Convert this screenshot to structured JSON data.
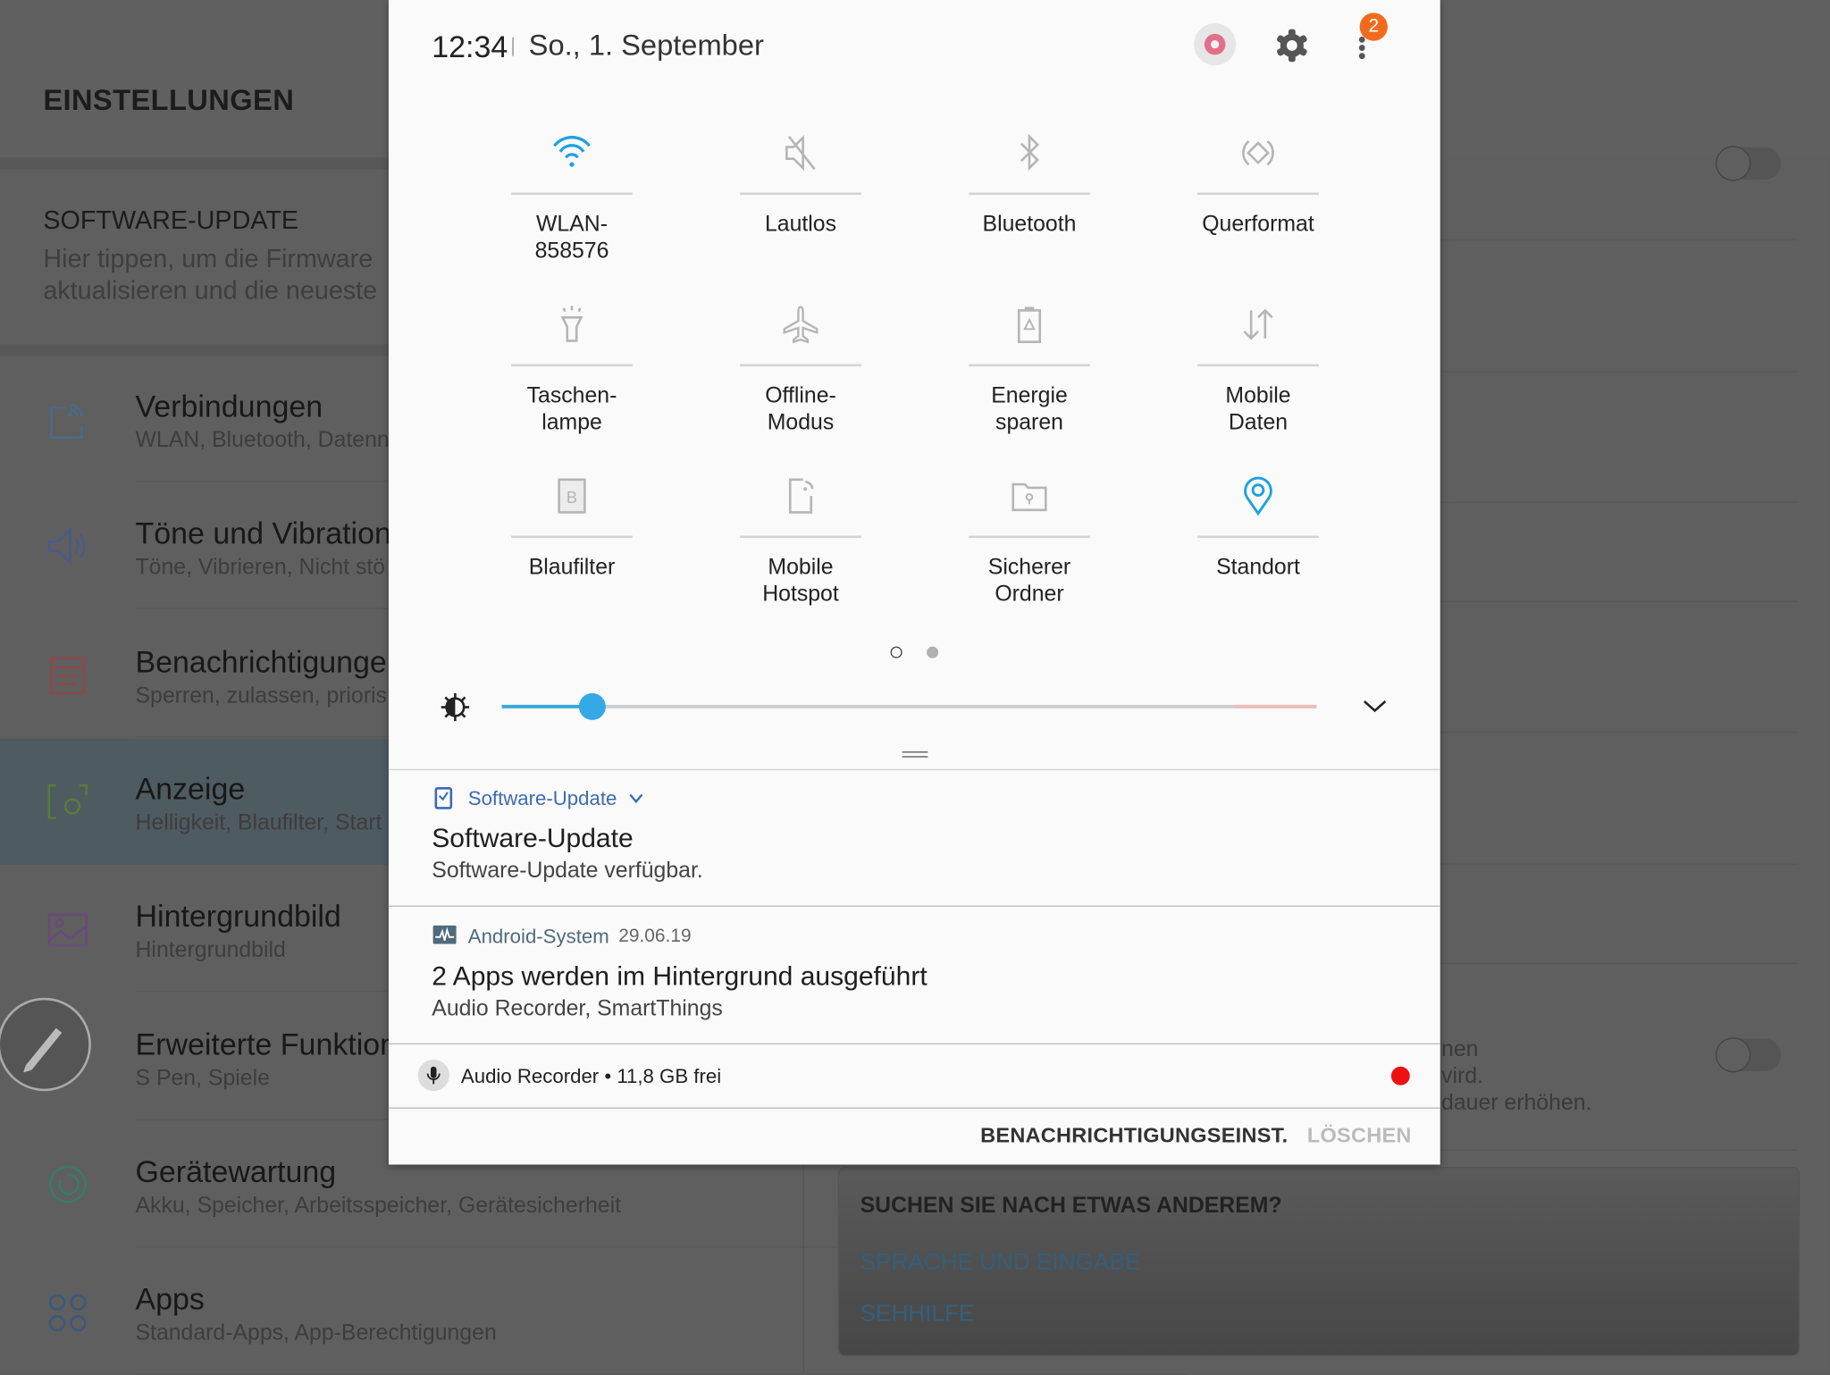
{
  "background": {
    "title": "EINSTELLUNGEN",
    "software_update": {
      "title": "SOFTWARE-UPDATE",
      "text_line1": "Hier tippen, um die Firmware",
      "text_line2": "aktualisieren und die neueste"
    },
    "items": [
      {
        "title": "Verbindungen",
        "subtitle": "WLAN, Bluetooth, Datenn",
        "icon": "connections-icon",
        "color": "#4a6a8a"
      },
      {
        "title": "Töne und Vibration",
        "subtitle": "Töne, Vibrieren, Nicht stö",
        "icon": "speaker-icon",
        "color": "#4a5a8a"
      },
      {
        "title": "Benachrichtigungen",
        "subtitle": "Sperren, zulassen, prioris",
        "icon": "notifications-icon",
        "color": "#8a4a4a"
      },
      {
        "title": "Anzeige",
        "subtitle": "Helligkeit, Blaufilter, Start",
        "icon": "display-icon",
        "color": "#5a7a3a",
        "selected": true
      },
      {
        "title": "Hintergrundbild",
        "subtitle": "Hintergrundbild",
        "icon": "wallpaper-icon",
        "color": "#6a4a7a"
      },
      {
        "title": "Erweiterte Funktion",
        "subtitle": "S Pen, Spiele",
        "icon": "advanced-features-icon",
        "color": "#7a6a3a"
      },
      {
        "title": "Gerätewartung",
        "subtitle": "Akku, Speicher, Arbeitsspeicher, Gerätesicherheit",
        "icon": "device-care-icon",
        "color": "#3a7a6a"
      },
      {
        "title": "Apps",
        "subtitle": "Standard-Apps, App-Berechtigungen",
        "icon": "apps-icon",
        "color": "#3a5a7a"
      }
    ],
    "right_text": [
      "nen",
      "vird.",
      "dauer erhöhen."
    ],
    "search_box": {
      "title": "SUCHEN SIE NACH ETWAS ANDEREM?",
      "links": [
        "SPRACHE UND EINGABE",
        "SEHHILFE"
      ]
    }
  },
  "panel": {
    "time": "12:34",
    "date": "So., 1. September",
    "badge_count": "2",
    "tiles": [
      {
        "label1": "WLAN-",
        "label2": "858576",
        "icon": "wifi-icon",
        "active": true
      },
      {
        "label1": "Lautlos",
        "label2": "",
        "icon": "mute-icon",
        "active": false
      },
      {
        "label1": "Bluetooth",
        "label2": "",
        "icon": "bluetooth-icon",
        "active": false
      },
      {
        "label1": "Querformat",
        "label2": "",
        "icon": "rotate-icon",
        "active": false
      },
      {
        "label1": "Taschen-",
        "label2": "lampe",
        "icon": "flashlight-icon",
        "active": false
      },
      {
        "label1": "Offline-",
        "label2": "Modus",
        "icon": "airplane-icon",
        "active": false
      },
      {
        "label1": "Energie",
        "label2": "sparen",
        "icon": "power-saving-icon",
        "active": false
      },
      {
        "label1": "Mobile",
        "label2": "Daten",
        "icon": "mobile-data-icon",
        "active": false
      },
      {
        "label1": "Blaufilter",
        "label2": "",
        "icon": "blue-light-filter-icon",
        "active": false
      },
      {
        "label1": "Mobile",
        "label2": "Hotspot",
        "icon": "hotspot-icon",
        "active": false
      },
      {
        "label1": "Sicherer",
        "label2": "Ordner",
        "icon": "secure-folder-icon",
        "active": false
      },
      {
        "label1": "Standort",
        "label2": "",
        "icon": "location-icon",
        "active": true
      }
    ],
    "page_indicator": {
      "current": 1,
      "total": 2
    },
    "brightness_percent": 11,
    "colors": {
      "accent": "#1ba1e2",
      "badge": "#f26b1d",
      "record": "#ee1111",
      "app_label": "#3d6bb4"
    },
    "notifications": [
      {
        "app": "Software-Update",
        "title": "Software-Update",
        "text": "Software-Update verfügbar."
      },
      {
        "app": "Android-System",
        "time": "29.06.19",
        "title": "2 Apps werden im Hintergrund ausgeführt",
        "text": "Audio Recorder, SmartThings"
      }
    ],
    "ongoing": {
      "app": "Audio Recorder",
      "text": "11,8 GB frei"
    },
    "buttons": {
      "settings": "BENACHRICHTIGUNGSEINST.",
      "clear": "LÖSCHEN"
    }
  }
}
